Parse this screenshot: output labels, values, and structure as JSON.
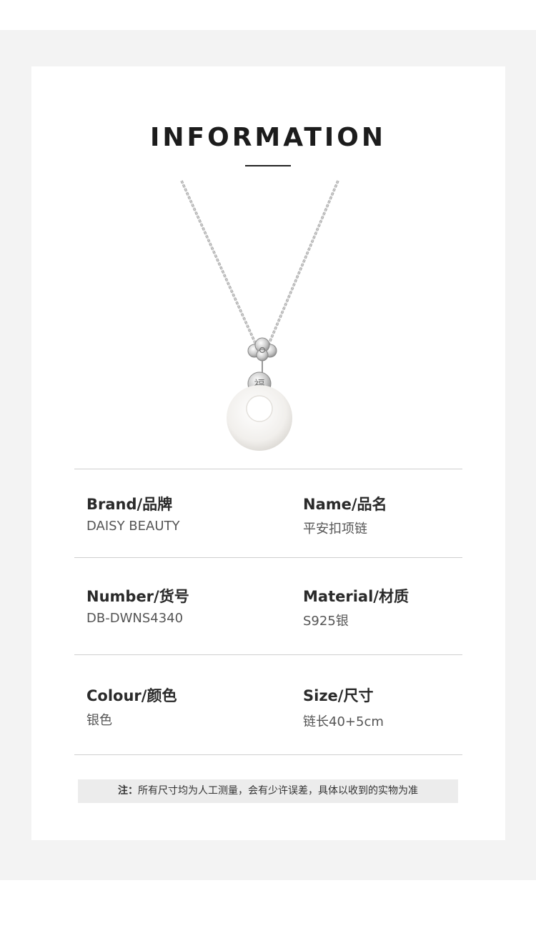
{
  "header": {
    "title": "INFORMATION"
  },
  "product": {
    "image_icon": "necklace-pendant-icon"
  },
  "specs": [
    {
      "label": "Brand/品牌",
      "value": "DAISY BEAUTY"
    },
    {
      "label": "Name/品名",
      "value": "平安扣项链"
    },
    {
      "label": "Number/货号",
      "value": "DB-DWNS4340"
    },
    {
      "label": "Material/材质",
      "value": "S925银"
    },
    {
      "label": "Colour/颜色",
      "value": "银色"
    },
    {
      "label": "Size/尺寸",
      "value": "链长40+5cm"
    }
  ],
  "note": {
    "prefix": "注：",
    "text": "所有尺寸均为人工测量，会有少许误差，具体以收到的实物为准"
  },
  "colors": {
    "page_bg": "#f3f3f3",
    "card_bg": "#ffffff",
    "divider": "#cfcfcf",
    "note_bg": "#ececec"
  }
}
